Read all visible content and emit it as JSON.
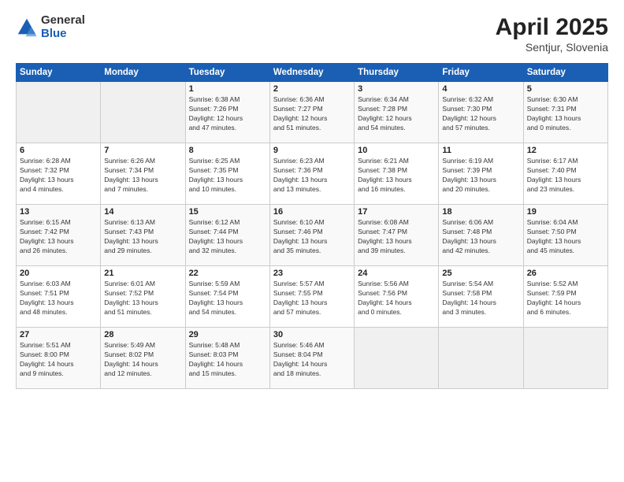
{
  "header": {
    "logo_general": "General",
    "logo_blue": "Blue",
    "title": "April 2025",
    "location": "Sentjur, Slovenia"
  },
  "weekdays": [
    "Sunday",
    "Monday",
    "Tuesday",
    "Wednesday",
    "Thursday",
    "Friday",
    "Saturday"
  ],
  "weeks": [
    [
      {
        "day": "",
        "info": ""
      },
      {
        "day": "",
        "info": ""
      },
      {
        "day": "1",
        "info": "Sunrise: 6:38 AM\nSunset: 7:26 PM\nDaylight: 12 hours\nand 47 minutes."
      },
      {
        "day": "2",
        "info": "Sunrise: 6:36 AM\nSunset: 7:27 PM\nDaylight: 12 hours\nand 51 minutes."
      },
      {
        "day": "3",
        "info": "Sunrise: 6:34 AM\nSunset: 7:28 PM\nDaylight: 12 hours\nand 54 minutes."
      },
      {
        "day": "4",
        "info": "Sunrise: 6:32 AM\nSunset: 7:30 PM\nDaylight: 12 hours\nand 57 minutes."
      },
      {
        "day": "5",
        "info": "Sunrise: 6:30 AM\nSunset: 7:31 PM\nDaylight: 13 hours\nand 0 minutes."
      }
    ],
    [
      {
        "day": "6",
        "info": "Sunrise: 6:28 AM\nSunset: 7:32 PM\nDaylight: 13 hours\nand 4 minutes."
      },
      {
        "day": "7",
        "info": "Sunrise: 6:26 AM\nSunset: 7:34 PM\nDaylight: 13 hours\nand 7 minutes."
      },
      {
        "day": "8",
        "info": "Sunrise: 6:25 AM\nSunset: 7:35 PM\nDaylight: 13 hours\nand 10 minutes."
      },
      {
        "day": "9",
        "info": "Sunrise: 6:23 AM\nSunset: 7:36 PM\nDaylight: 13 hours\nand 13 minutes."
      },
      {
        "day": "10",
        "info": "Sunrise: 6:21 AM\nSunset: 7:38 PM\nDaylight: 13 hours\nand 16 minutes."
      },
      {
        "day": "11",
        "info": "Sunrise: 6:19 AM\nSunset: 7:39 PM\nDaylight: 13 hours\nand 20 minutes."
      },
      {
        "day": "12",
        "info": "Sunrise: 6:17 AM\nSunset: 7:40 PM\nDaylight: 13 hours\nand 23 minutes."
      }
    ],
    [
      {
        "day": "13",
        "info": "Sunrise: 6:15 AM\nSunset: 7:42 PM\nDaylight: 13 hours\nand 26 minutes."
      },
      {
        "day": "14",
        "info": "Sunrise: 6:13 AM\nSunset: 7:43 PM\nDaylight: 13 hours\nand 29 minutes."
      },
      {
        "day": "15",
        "info": "Sunrise: 6:12 AM\nSunset: 7:44 PM\nDaylight: 13 hours\nand 32 minutes."
      },
      {
        "day": "16",
        "info": "Sunrise: 6:10 AM\nSunset: 7:46 PM\nDaylight: 13 hours\nand 35 minutes."
      },
      {
        "day": "17",
        "info": "Sunrise: 6:08 AM\nSunset: 7:47 PM\nDaylight: 13 hours\nand 39 minutes."
      },
      {
        "day": "18",
        "info": "Sunrise: 6:06 AM\nSunset: 7:48 PM\nDaylight: 13 hours\nand 42 minutes."
      },
      {
        "day": "19",
        "info": "Sunrise: 6:04 AM\nSunset: 7:50 PM\nDaylight: 13 hours\nand 45 minutes."
      }
    ],
    [
      {
        "day": "20",
        "info": "Sunrise: 6:03 AM\nSunset: 7:51 PM\nDaylight: 13 hours\nand 48 minutes."
      },
      {
        "day": "21",
        "info": "Sunrise: 6:01 AM\nSunset: 7:52 PM\nDaylight: 13 hours\nand 51 minutes."
      },
      {
        "day": "22",
        "info": "Sunrise: 5:59 AM\nSunset: 7:54 PM\nDaylight: 13 hours\nand 54 minutes."
      },
      {
        "day": "23",
        "info": "Sunrise: 5:57 AM\nSunset: 7:55 PM\nDaylight: 13 hours\nand 57 minutes."
      },
      {
        "day": "24",
        "info": "Sunrise: 5:56 AM\nSunset: 7:56 PM\nDaylight: 14 hours\nand 0 minutes."
      },
      {
        "day": "25",
        "info": "Sunrise: 5:54 AM\nSunset: 7:58 PM\nDaylight: 14 hours\nand 3 minutes."
      },
      {
        "day": "26",
        "info": "Sunrise: 5:52 AM\nSunset: 7:59 PM\nDaylight: 14 hours\nand 6 minutes."
      }
    ],
    [
      {
        "day": "27",
        "info": "Sunrise: 5:51 AM\nSunset: 8:00 PM\nDaylight: 14 hours\nand 9 minutes."
      },
      {
        "day": "28",
        "info": "Sunrise: 5:49 AM\nSunset: 8:02 PM\nDaylight: 14 hours\nand 12 minutes."
      },
      {
        "day": "29",
        "info": "Sunrise: 5:48 AM\nSunset: 8:03 PM\nDaylight: 14 hours\nand 15 minutes."
      },
      {
        "day": "30",
        "info": "Sunrise: 5:46 AM\nSunset: 8:04 PM\nDaylight: 14 hours\nand 18 minutes."
      },
      {
        "day": "",
        "info": ""
      },
      {
        "day": "",
        "info": ""
      },
      {
        "day": "",
        "info": ""
      }
    ]
  ]
}
